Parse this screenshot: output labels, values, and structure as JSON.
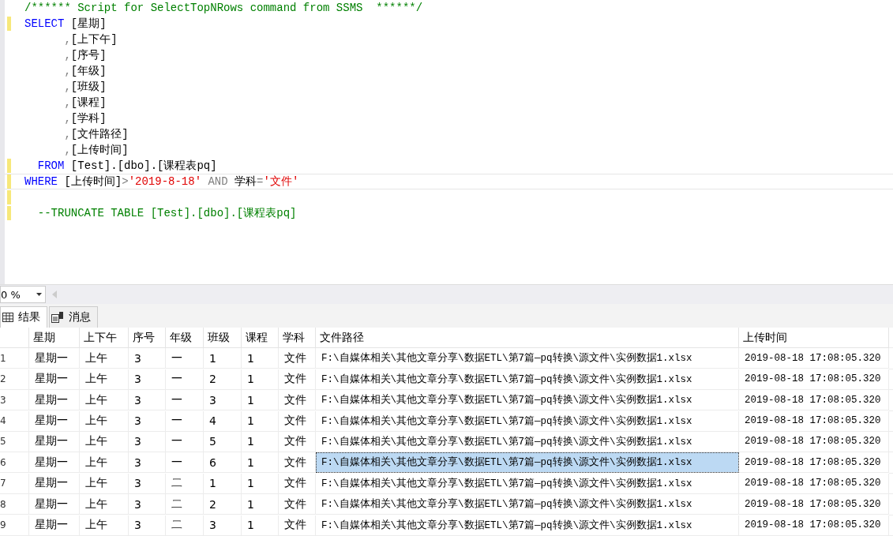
{
  "editor": {
    "lines": [
      {
        "changed": false,
        "current": false,
        "tokens": [
          {
            "kind": "comment",
            "text": "/****** Script for SelectTopNRows command from SSMS  ******/"
          }
        ]
      },
      {
        "changed": true,
        "current": false,
        "tokens": [
          {
            "kind": "keyword",
            "text": "SELECT"
          },
          {
            "kind": "text",
            "text": " [星期]"
          }
        ]
      },
      {
        "changed": false,
        "current": false,
        "tokens": [
          {
            "kind": "operator",
            "text": "      ,"
          },
          {
            "kind": "text",
            "text": "[上下午]"
          }
        ]
      },
      {
        "changed": false,
        "current": false,
        "tokens": [
          {
            "kind": "operator",
            "text": "      ,"
          },
          {
            "kind": "text",
            "text": "[序号]"
          }
        ]
      },
      {
        "changed": false,
        "current": false,
        "tokens": [
          {
            "kind": "operator",
            "text": "      ,"
          },
          {
            "kind": "text",
            "text": "[年级]"
          }
        ]
      },
      {
        "changed": false,
        "current": false,
        "tokens": [
          {
            "kind": "operator",
            "text": "      ,"
          },
          {
            "kind": "text",
            "text": "[班级]"
          }
        ]
      },
      {
        "changed": false,
        "current": false,
        "tokens": [
          {
            "kind": "operator",
            "text": "      ,"
          },
          {
            "kind": "text",
            "text": "[课程]"
          }
        ]
      },
      {
        "changed": false,
        "current": false,
        "tokens": [
          {
            "kind": "operator",
            "text": "      ,"
          },
          {
            "kind": "text",
            "text": "[学科]"
          }
        ]
      },
      {
        "changed": false,
        "current": false,
        "tokens": [
          {
            "kind": "operator",
            "text": "      ,"
          },
          {
            "kind": "text",
            "text": "[文件路径]"
          }
        ]
      },
      {
        "changed": false,
        "current": false,
        "tokens": [
          {
            "kind": "operator",
            "text": "      ,"
          },
          {
            "kind": "text",
            "text": "[上传时间]"
          }
        ]
      },
      {
        "changed": true,
        "current": false,
        "tokens": [
          {
            "kind": "keyword",
            "text": "  FROM"
          },
          {
            "kind": "text",
            "text": " [Test].[dbo].[课程表pq]"
          }
        ]
      },
      {
        "changed": true,
        "current": true,
        "tokens": [
          {
            "kind": "keyword",
            "text": "WHERE"
          },
          {
            "kind": "text",
            "text": " [上传时间]"
          },
          {
            "kind": "operator",
            "text": ">"
          },
          {
            "kind": "string",
            "text": "'2019-8-18'"
          },
          {
            "kind": "operator",
            "text": " AND "
          },
          {
            "kind": "text",
            "text": "学科"
          },
          {
            "kind": "operator",
            "text": "="
          },
          {
            "kind": "string",
            "text": "'文件'"
          }
        ]
      },
      {
        "changed": true,
        "current": false
      },
      {
        "changed": true,
        "current": false,
        "tokens": [
          {
            "kind": "comment",
            "text": "  --TRUNCATE TABLE [Test].[dbo].[课程表pq]"
          }
        ]
      }
    ]
  },
  "zoom": {
    "value": "0 %"
  },
  "tabs": [
    {
      "label": "结果",
      "selected": true
    },
    {
      "label": "消息",
      "selected": false
    }
  ],
  "grid": {
    "columns": [
      "星期",
      "上下午",
      "序号",
      "年级",
      "班级",
      "课程",
      "学科",
      "文件路径",
      "上传时间"
    ],
    "rows": [
      {
        "number": "1",
        "selected": false,
        "cells": [
          "星期一",
          "上午",
          "3",
          "一",
          "1",
          "1",
          "文件",
          "F:\\自媒体相关\\其他文章分享\\数据ETL\\第7篇—pq转换\\源文件\\实例数据1.xlsx",
          "2019-08-18 17:08:05.320"
        ]
      },
      {
        "number": "2",
        "selected": false,
        "cells": [
          "星期一",
          "上午",
          "3",
          "一",
          "2",
          "1",
          "文件",
          "F:\\自媒体相关\\其他文章分享\\数据ETL\\第7篇—pq转换\\源文件\\实例数据1.xlsx",
          "2019-08-18 17:08:05.320"
        ]
      },
      {
        "number": "3",
        "selected": false,
        "cells": [
          "星期一",
          "上午",
          "3",
          "一",
          "3",
          "1",
          "文件",
          "F:\\自媒体相关\\其他文章分享\\数据ETL\\第7篇—pq转换\\源文件\\实例数据1.xlsx",
          "2019-08-18 17:08:05.320"
        ]
      },
      {
        "number": "4",
        "selected": false,
        "cells": [
          "星期一",
          "上午",
          "3",
          "一",
          "4",
          "1",
          "文件",
          "F:\\自媒体相关\\其他文章分享\\数据ETL\\第7篇—pq转换\\源文件\\实例数据1.xlsx",
          "2019-08-18 17:08:05.320"
        ]
      },
      {
        "number": "5",
        "selected": false,
        "cells": [
          "星期一",
          "上午",
          "3",
          "一",
          "5",
          "1",
          "文件",
          "F:\\自媒体相关\\其他文章分享\\数据ETL\\第7篇—pq转换\\源文件\\实例数据1.xlsx",
          "2019-08-18 17:08:05.320"
        ]
      },
      {
        "number": "6",
        "selected": true,
        "cells": [
          "星期一",
          "上午",
          "3",
          "一",
          "6",
          "1",
          "文件",
          "F:\\自媒体相关\\其他文章分享\\数据ETL\\第7篇—pq转换\\源文件\\实例数据1.xlsx",
          "2019-08-18 17:08:05.320"
        ]
      },
      {
        "number": "7",
        "selected": false,
        "cells": [
          "星期一",
          "上午",
          "3",
          "二",
          "1",
          "1",
          "文件",
          "F:\\自媒体相关\\其他文章分享\\数据ETL\\第7篇—pq转换\\源文件\\实例数据1.xlsx",
          "2019-08-18 17:08:05.320"
        ]
      },
      {
        "number": "8",
        "selected": false,
        "cells": [
          "星期一",
          "上午",
          "3",
          "二",
          "2",
          "1",
          "文件",
          "F:\\自媒体相关\\其他文章分享\\数据ETL\\第7篇—pq转换\\源文件\\实例数据1.xlsx",
          "2019-08-18 17:08:05.320"
        ]
      },
      {
        "number": "9",
        "selected": false,
        "cells": [
          "星期一",
          "上午",
          "3",
          "二",
          "3",
          "1",
          "文件",
          "F:\\自媒体相关\\其他文章分享\\数据ETL\\第7篇—pq转换\\源文件\\实例数据1.xlsx",
          "2019-08-18 17:08:05.320"
        ]
      }
    ]
  }
}
